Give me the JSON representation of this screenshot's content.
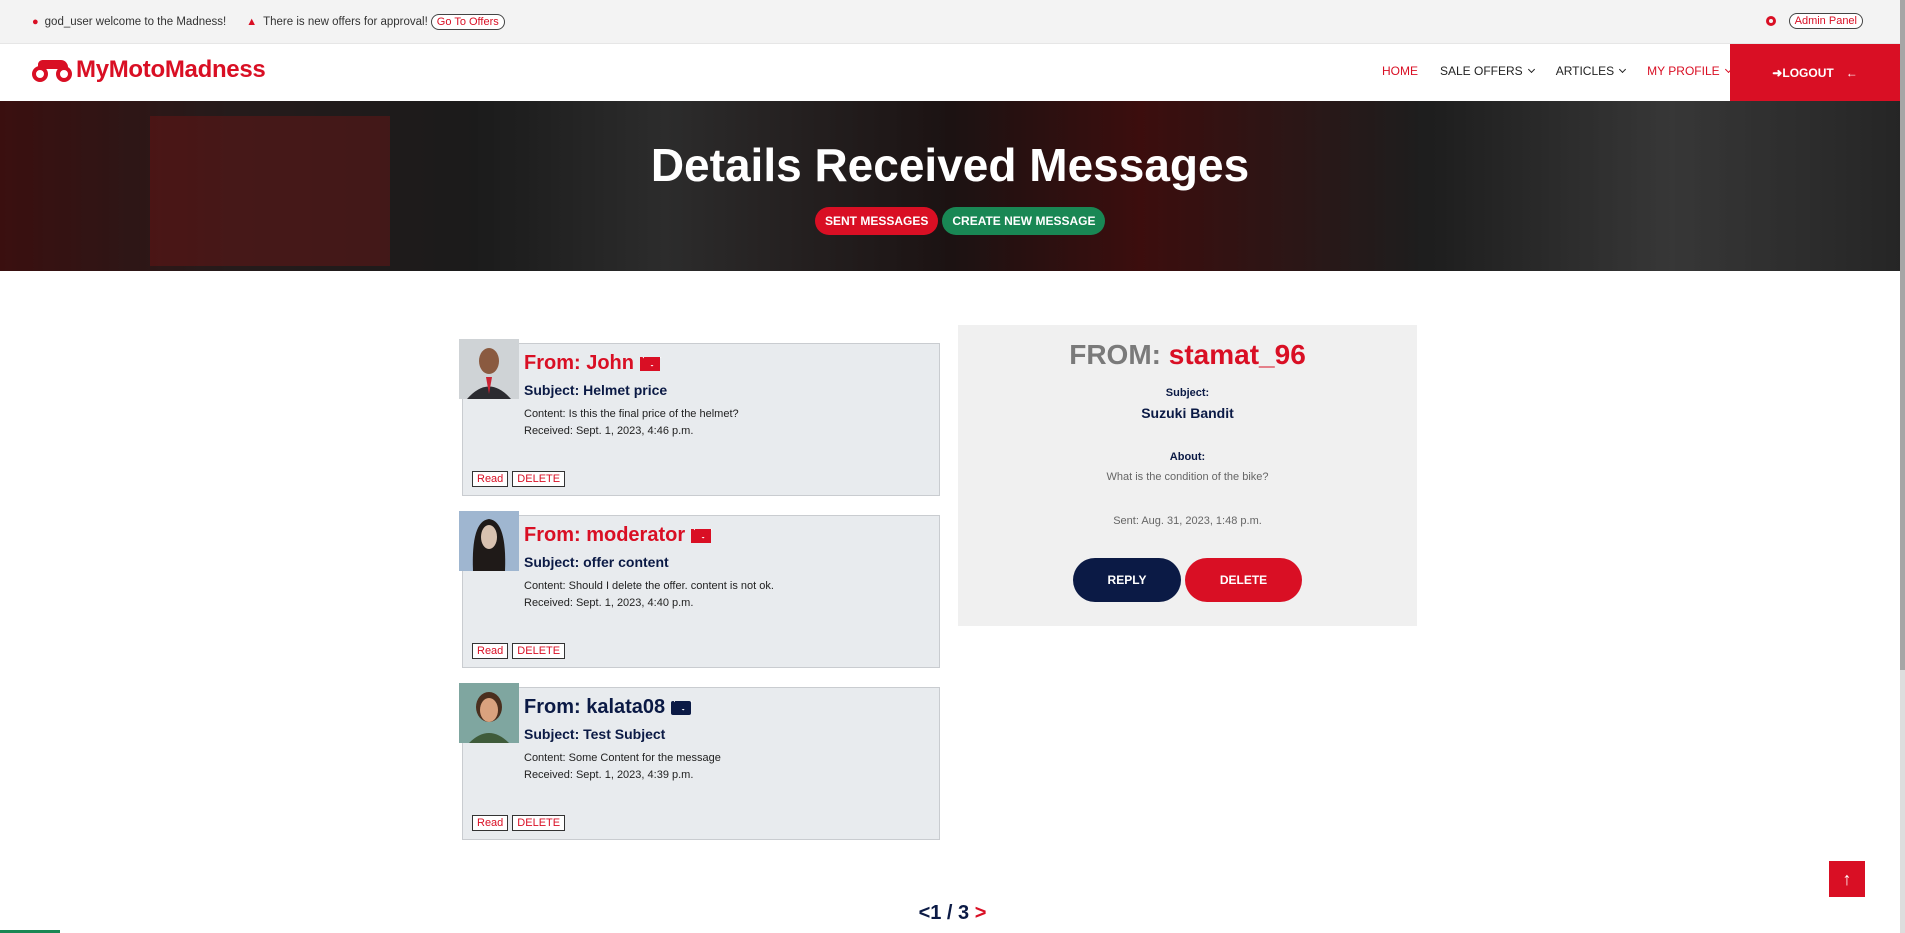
{
  "topbar": {
    "welcome": "god_user welcome to the Madness!",
    "notice": "There is new offers for approval!",
    "go_offers": "Go To Offers",
    "admin_panel": "Admin Panel"
  },
  "nav": {
    "brand": "MyMotoMadness",
    "links": [
      {
        "label": "HOME"
      },
      {
        "label": "SALE OFFERS"
      },
      {
        "label": "ARTICLES"
      },
      {
        "label": "MY PROFILE"
      }
    ],
    "logout": "LOGOUT"
  },
  "hero": {
    "title": "Details Received Messages",
    "sent_btn": "SENT MESSAGES",
    "create_btn": "CREATE NEW MESSAGE"
  },
  "messages": [
    {
      "from": "From: John",
      "subject": "Subject: Helmet price",
      "content": "Content: Is this the final price of the helmet?",
      "received": "Received: Sept. 1, 2023, 4:46 p.m.",
      "read_label": "Read",
      "delete_label": "DELETE",
      "unread": true
    },
    {
      "from": "From: moderator",
      "subject": "Subject: offer content",
      "content": "Content: Should I delete the offer. content is not ok.",
      "received": "Received: Sept. 1, 2023, 4:40 p.m.",
      "read_label": "Read",
      "delete_label": "DELETE",
      "unread": true
    },
    {
      "from": "From: kalata08",
      "subject": "Subject: Test Subject",
      "content": "Content: Some Content for the message",
      "received": "Received: Sept. 1, 2023, 4:39 p.m.",
      "read_label": "Read",
      "delete_label": "DELETE",
      "unread": false
    }
  ],
  "detail": {
    "from_label": "FROM:",
    "from_value": "stamat_96",
    "subject_label": "Subject:",
    "subject_value": "Suzuki Bandit",
    "about_label": "About:",
    "about_value": "What is the condition of the bike?",
    "sent": "Sent: Aug. 31, 2023, 1:48 p.m.",
    "reply": "REPLY",
    "delete": "DELETE"
  },
  "pagination": {
    "prev": "<",
    "page": "1 / 3",
    "next": ">"
  },
  "colors": {
    "accent": "#d90f24",
    "navy": "#0b1a45",
    "green": "#198754"
  }
}
